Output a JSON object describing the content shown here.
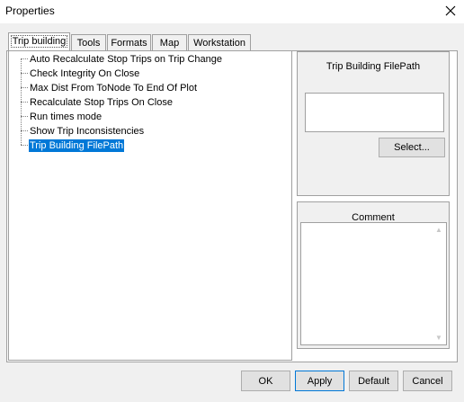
{
  "window": {
    "title": "Properties",
    "close_glyph": "✕"
  },
  "tabs": [
    {
      "label": "Trip building",
      "active": true
    },
    {
      "label": "Tools",
      "active": false
    },
    {
      "label": "Formats",
      "active": false
    },
    {
      "label": "Map",
      "active": false
    },
    {
      "label": "Workstation",
      "active": false
    }
  ],
  "tree": {
    "items": [
      {
        "label": "Auto Recalculate Stop Trips on Trip Change",
        "selected": false
      },
      {
        "label": "Check Integrity On Close",
        "selected": false
      },
      {
        "label": "Max Dist From ToNode To End Of Plot",
        "selected": false
      },
      {
        "label": "Recalculate Stop Trips On Close",
        "selected": false
      },
      {
        "label": "Run times mode",
        "selected": false
      },
      {
        "label": "Show Trip Inconsistencies",
        "selected": false
      },
      {
        "label": "Trip Building FilePath",
        "selected": true
      }
    ]
  },
  "value_panel": {
    "title": "Trip Building FilePath",
    "value": "",
    "select_label": "Select..."
  },
  "comment_panel": {
    "title": "Comment",
    "text": ""
  },
  "footer": {
    "ok_label": "OK",
    "apply_label": "Apply",
    "default_label": "Default",
    "cancel_label": "Cancel"
  },
  "colors": {
    "selection": "#0078d7",
    "background": "#f0f0f0"
  }
}
